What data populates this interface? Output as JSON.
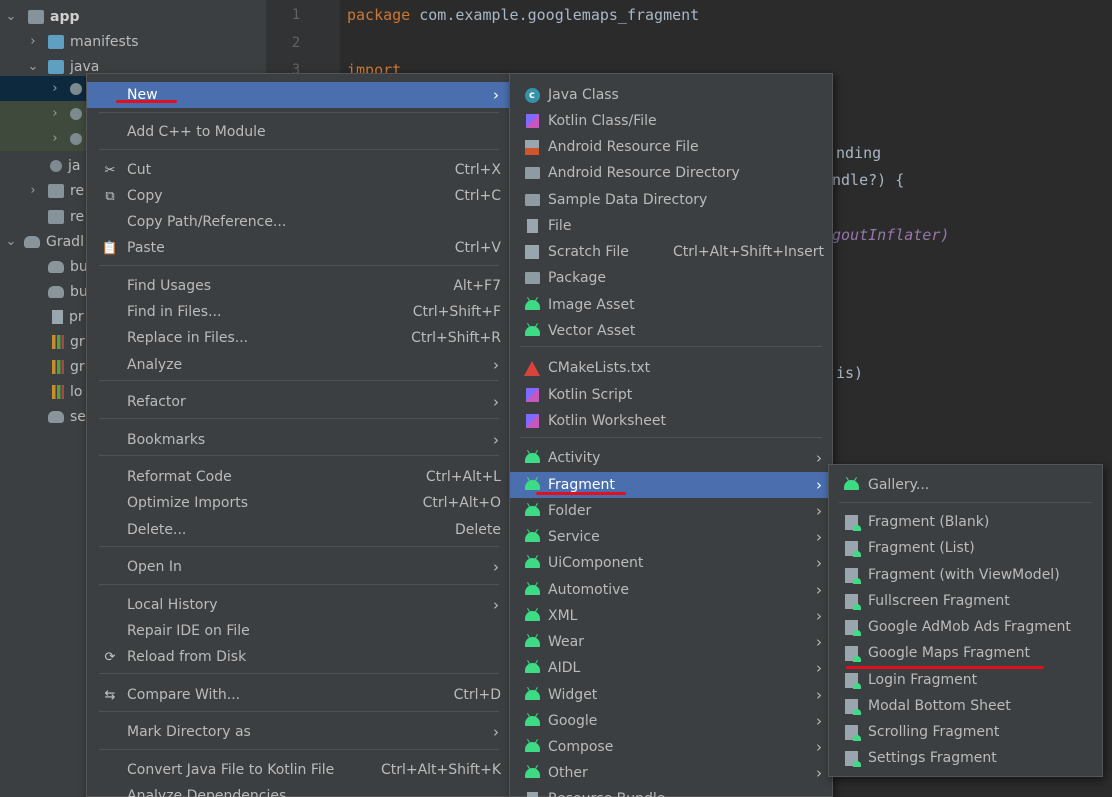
{
  "tree": {
    "items": [
      {
        "label": "app",
        "chevron": "down"
      },
      {
        "label": "manifests",
        "chevron": "right"
      },
      {
        "label": "java",
        "chevron": "down"
      },
      {
        "label": "",
        "chevron": "right"
      },
      {
        "label": "",
        "chevron": "right"
      },
      {
        "label": "",
        "chevron": "right"
      },
      {
        "label": "ja",
        "chevron": ""
      },
      {
        "label": "re",
        "chevron": "right"
      },
      {
        "label": "re",
        "chevron": ""
      },
      {
        "label": "Gradl",
        "chevron": "down"
      },
      {
        "label": "bu",
        "chevron": ""
      },
      {
        "label": "bu",
        "chevron": ""
      },
      {
        "label": "pr",
        "chevron": ""
      },
      {
        "label": "gr",
        "chevron": ""
      },
      {
        "label": "gr",
        "chevron": ""
      },
      {
        "label": "lo",
        "chevron": ""
      },
      {
        "label": "se",
        "chevron": ""
      }
    ]
  },
  "editor": {
    "line_numbers": [
      "1",
      "2",
      "3"
    ],
    "package_keyword": "package",
    "package_name": "com.example.googlemaps_fragment",
    "import_keyword": "import",
    "fragments": [
      "nding",
      "ndle?) {",
      "goutInflater)",
      "is)"
    ]
  },
  "menu_main": {
    "items": [
      {
        "label": "New",
        "shortcut": "",
        "submenu": true,
        "icon": ""
      },
      {
        "label": "Add C++ to Module",
        "shortcut": "",
        "submenu": false,
        "icon": ""
      },
      {
        "label": "Cut",
        "shortcut": "Ctrl+X",
        "submenu": false,
        "icon": "scissors-icon"
      },
      {
        "label": "Copy",
        "shortcut": "Ctrl+C",
        "submenu": false,
        "icon": "copy-icon"
      },
      {
        "label": "Copy Path/Reference...",
        "shortcut": "",
        "submenu": false,
        "icon": ""
      },
      {
        "label": "Paste",
        "shortcut": "Ctrl+V",
        "submenu": false,
        "icon": "clipboard-icon"
      },
      {
        "label": "Find Usages",
        "shortcut": "Alt+F7",
        "submenu": false,
        "icon": ""
      },
      {
        "label": "Find in Files...",
        "shortcut": "Ctrl+Shift+F",
        "submenu": false,
        "icon": ""
      },
      {
        "label": "Replace in Files...",
        "shortcut": "Ctrl+Shift+R",
        "submenu": false,
        "icon": ""
      },
      {
        "label": "Analyze",
        "shortcut": "",
        "submenu": true,
        "icon": ""
      },
      {
        "label": "Refactor",
        "shortcut": "",
        "submenu": true,
        "icon": ""
      },
      {
        "label": "Bookmarks",
        "shortcut": "",
        "submenu": true,
        "icon": ""
      },
      {
        "label": "Reformat Code",
        "shortcut": "Ctrl+Alt+L",
        "submenu": false,
        "icon": ""
      },
      {
        "label": "Optimize Imports",
        "shortcut": "Ctrl+Alt+O",
        "submenu": false,
        "icon": ""
      },
      {
        "label": "Delete...",
        "shortcut": "Delete",
        "submenu": false,
        "icon": ""
      },
      {
        "label": "Open In",
        "shortcut": "",
        "submenu": true,
        "icon": ""
      },
      {
        "label": "Local History",
        "shortcut": "",
        "submenu": true,
        "icon": ""
      },
      {
        "label": "Repair IDE on File",
        "shortcut": "",
        "submenu": false,
        "icon": ""
      },
      {
        "label": "Reload from Disk",
        "shortcut": "",
        "submenu": false,
        "icon": "reload-icon"
      },
      {
        "label": "Compare With...",
        "shortcut": "Ctrl+D",
        "submenu": false,
        "icon": "compare-icon"
      },
      {
        "label": "Mark Directory as",
        "shortcut": "",
        "submenu": true,
        "icon": ""
      },
      {
        "label": "Convert Java File to Kotlin File",
        "shortcut": "Ctrl+Alt+Shift+K",
        "submenu": false,
        "icon": ""
      },
      {
        "label": "Analyze Dependencies...",
        "shortcut": "",
        "submenu": false,
        "icon": ""
      }
    ]
  },
  "menu_new": {
    "items": [
      {
        "label": "Java Class",
        "shortcut": "",
        "submenu": false,
        "icon": "java-class-icon"
      },
      {
        "label": "Kotlin Class/File",
        "shortcut": "",
        "submenu": false,
        "icon": "kotlin-icon"
      },
      {
        "label": "Android Resource File",
        "shortcut": "",
        "submenu": false,
        "icon": "resource-file-icon"
      },
      {
        "label": "Android Resource Directory",
        "shortcut": "",
        "submenu": false,
        "icon": "folder-icon"
      },
      {
        "label": "Sample Data Directory",
        "shortcut": "",
        "submenu": false,
        "icon": "folder-icon"
      },
      {
        "label": "File",
        "shortcut": "",
        "submenu": false,
        "icon": "file-icon"
      },
      {
        "label": "Scratch File",
        "shortcut": "Ctrl+Alt+Shift+Insert",
        "submenu": false,
        "icon": "scratch-file-icon"
      },
      {
        "label": "Package",
        "shortcut": "",
        "submenu": false,
        "icon": "package-icon"
      },
      {
        "label": "Image Asset",
        "shortcut": "",
        "submenu": false,
        "icon": "android-icon"
      },
      {
        "label": "Vector Asset",
        "shortcut": "",
        "submenu": false,
        "icon": "android-icon"
      },
      {
        "label": "CMakeLists.txt",
        "shortcut": "",
        "submenu": false,
        "icon": "cmake-icon"
      },
      {
        "label": "Kotlin Script",
        "shortcut": "",
        "submenu": false,
        "icon": "kotlin-icon"
      },
      {
        "label": "Kotlin Worksheet",
        "shortcut": "",
        "submenu": false,
        "icon": "kotlin-icon"
      },
      {
        "label": "Activity",
        "shortcut": "",
        "submenu": true,
        "icon": "android-icon"
      },
      {
        "label": "Fragment",
        "shortcut": "",
        "submenu": true,
        "icon": "android-icon"
      },
      {
        "label": "Folder",
        "shortcut": "",
        "submenu": true,
        "icon": "android-icon"
      },
      {
        "label": "Service",
        "shortcut": "",
        "submenu": true,
        "icon": "android-icon"
      },
      {
        "label": "UiComponent",
        "shortcut": "",
        "submenu": true,
        "icon": "android-icon"
      },
      {
        "label": "Automotive",
        "shortcut": "",
        "submenu": true,
        "icon": "android-icon"
      },
      {
        "label": "XML",
        "shortcut": "",
        "submenu": true,
        "icon": "android-icon"
      },
      {
        "label": "Wear",
        "shortcut": "",
        "submenu": true,
        "icon": "android-icon"
      },
      {
        "label": "AIDL",
        "shortcut": "",
        "submenu": true,
        "icon": "android-icon"
      },
      {
        "label": "Widget",
        "shortcut": "",
        "submenu": true,
        "icon": "android-icon"
      },
      {
        "label": "Google",
        "shortcut": "",
        "submenu": true,
        "icon": "android-icon"
      },
      {
        "label": "Compose",
        "shortcut": "",
        "submenu": true,
        "icon": "android-icon"
      },
      {
        "label": "Other",
        "shortcut": "",
        "submenu": true,
        "icon": "android-icon"
      },
      {
        "label": "Resource Bundle",
        "shortcut": "",
        "submenu": false,
        "icon": "resource-bundle-icon"
      }
    ]
  },
  "menu_fragment": {
    "items": [
      {
        "label": "Gallery...",
        "icon": "android-icon"
      },
      {
        "label": "Fragment (Blank)",
        "icon": "fragment-icon"
      },
      {
        "label": "Fragment (List)",
        "icon": "fragment-icon"
      },
      {
        "label": "Fragment (with ViewModel)",
        "icon": "fragment-icon"
      },
      {
        "label": "Fullscreen Fragment",
        "icon": "fragment-icon"
      },
      {
        "label": "Google AdMob Ads Fragment",
        "icon": "fragment-icon"
      },
      {
        "label": "Google Maps Fragment",
        "icon": "fragment-icon"
      },
      {
        "label": "Login Fragment",
        "icon": "fragment-icon"
      },
      {
        "label": "Modal Bottom Sheet",
        "icon": "fragment-icon"
      },
      {
        "label": "Scrolling Fragment",
        "icon": "fragment-icon"
      },
      {
        "label": "Settings Fragment",
        "icon": "fragment-icon"
      }
    ]
  },
  "colors": {
    "highlight": "#4b6eaf",
    "annotation_underline": "#e0101e",
    "android_green": "#3ddc84"
  }
}
